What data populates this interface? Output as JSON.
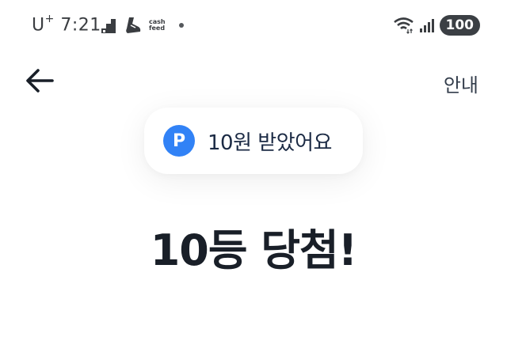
{
  "status_bar": {
    "carrier": "U",
    "carrier_sup": "+",
    "time": "7:21",
    "cashfeed_line1": "cash",
    "cashfeed_line2": "feed",
    "battery": "100"
  },
  "nav": {
    "back_icon": "arrow-left-icon",
    "info_label": "안내"
  },
  "reward": {
    "icon_letter": "P",
    "icon_color": "#3182f6",
    "text": "10원 받았어요"
  },
  "headline": "10등 당첨!"
}
